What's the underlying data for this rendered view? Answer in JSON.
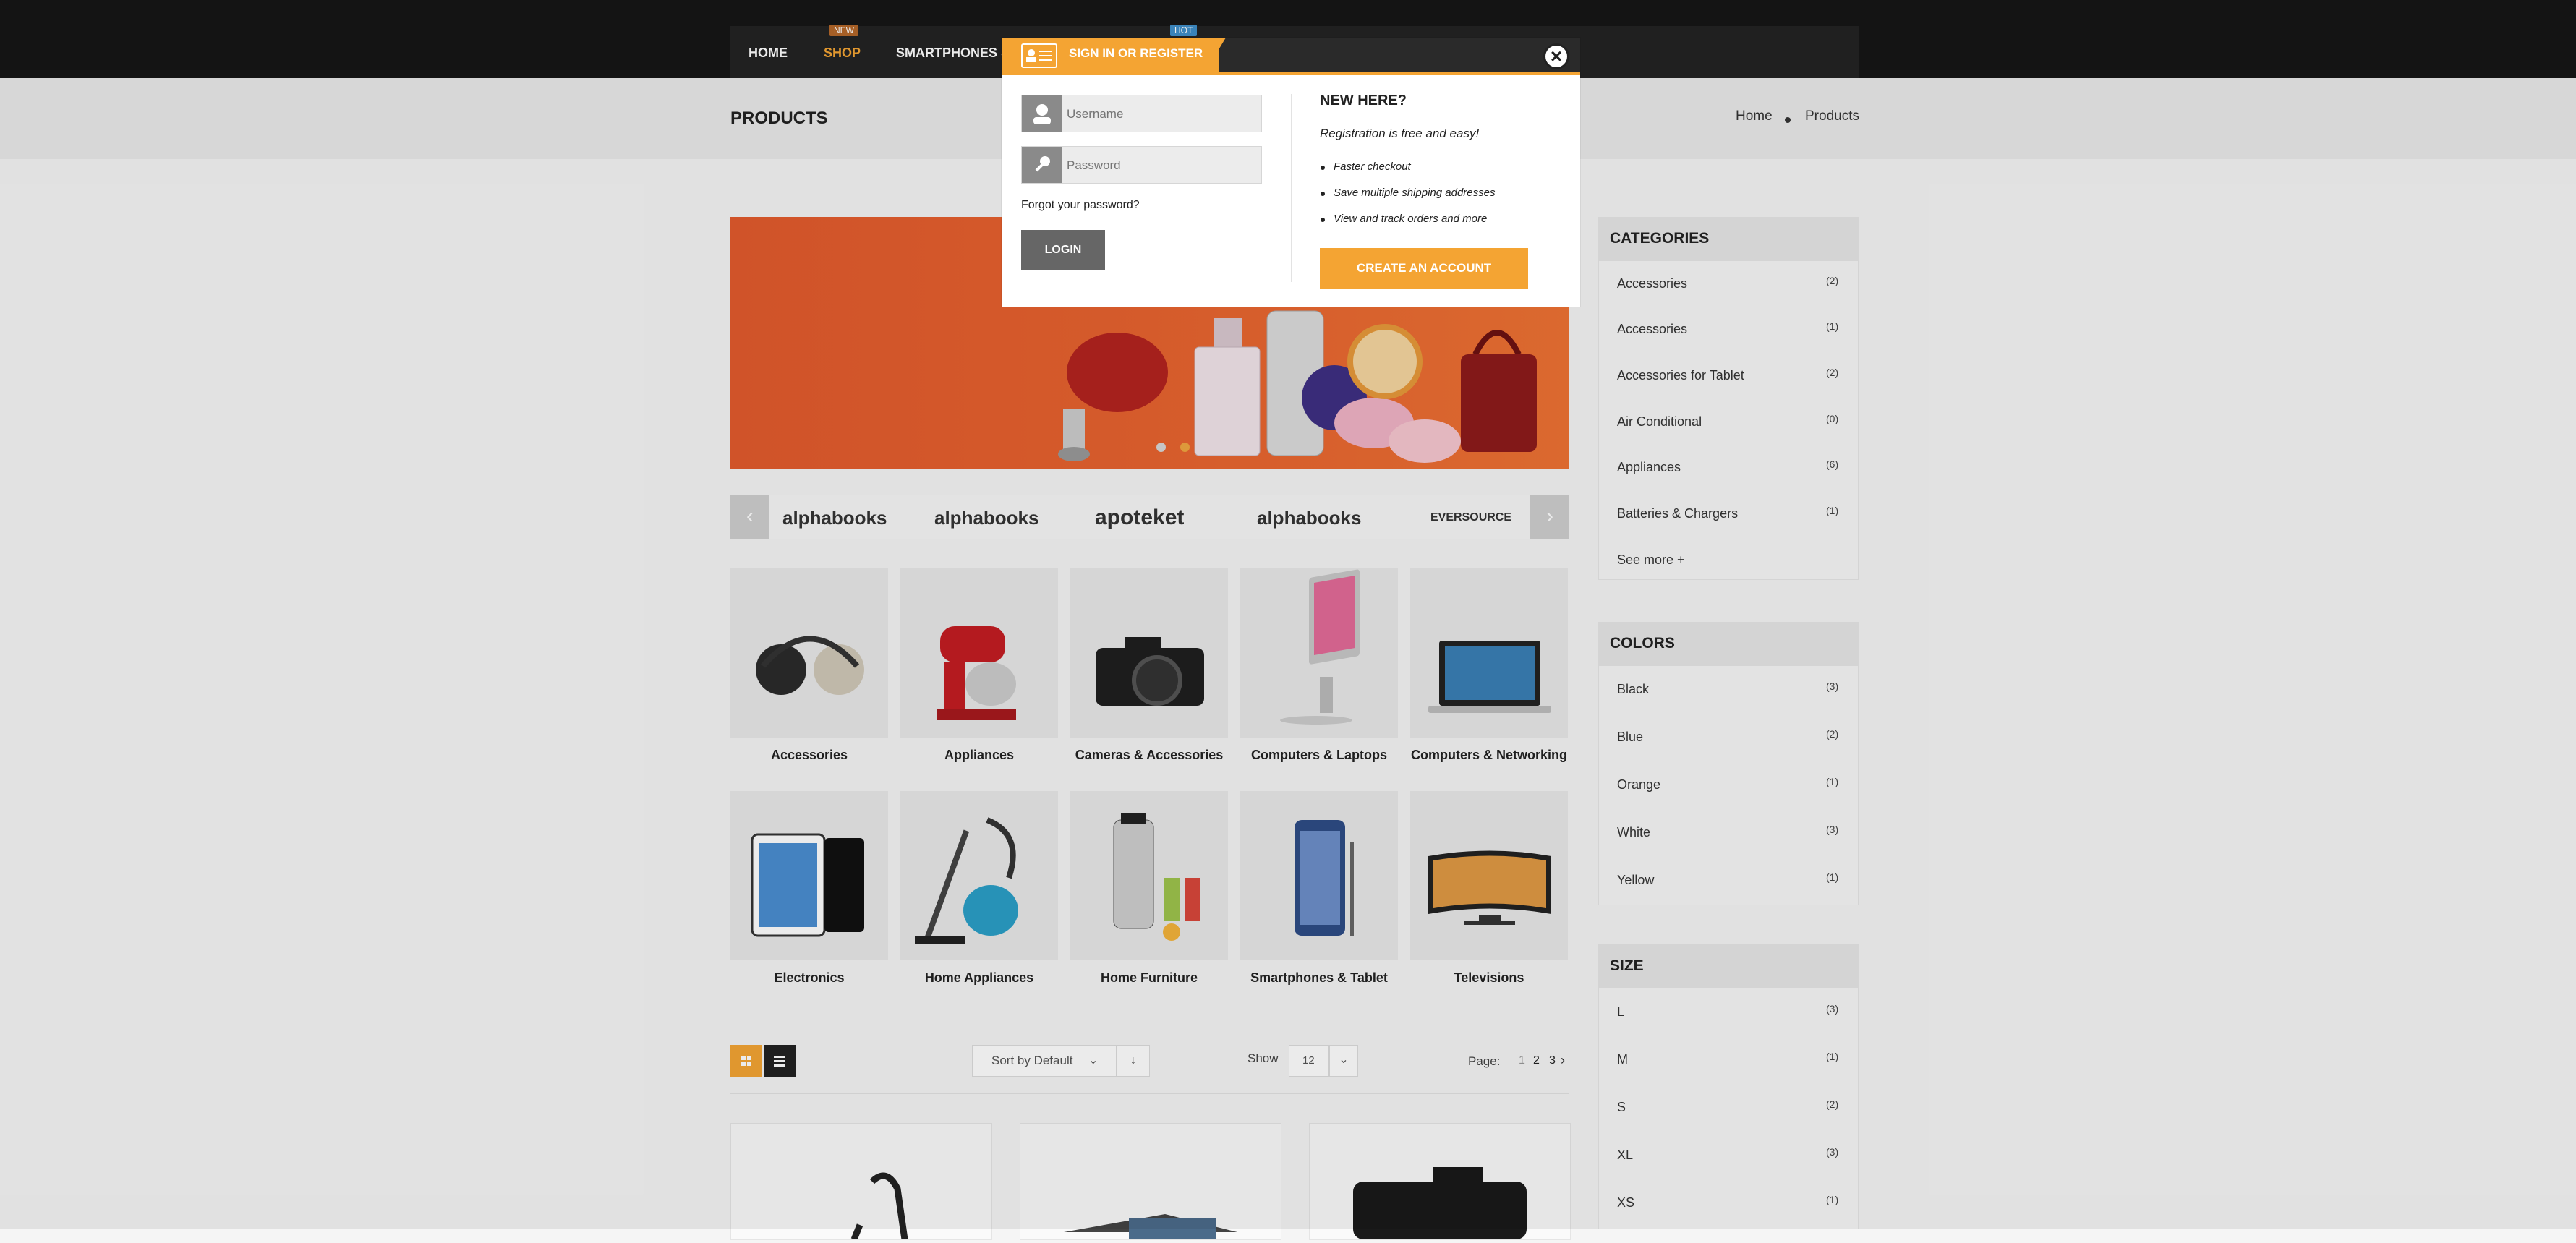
{
  "nav": {
    "items": [
      {
        "label": "HOME"
      },
      {
        "label": "SHOP",
        "badge": "NEW"
      },
      {
        "label": "SMARTPHONES &",
        "badge": "HOT"
      }
    ]
  },
  "header": {
    "page_title": "PRODUCTS",
    "breadcrumb": [
      "Home",
      "Products"
    ]
  },
  "slider": {
    "dots": 2
  },
  "brands": {
    "logos": [
      "alphabooks",
      "alphabooks",
      "apoteket",
      "alphabooks",
      "EVERSOURCE"
    ],
    "prev_icon": "chevron-left-icon",
    "next_icon": "chevron-right-icon"
  },
  "categories": [
    {
      "label": "Accessories",
      "icon": "headphones"
    },
    {
      "label": "Appliances",
      "icon": "stand-mixer"
    },
    {
      "label": "Cameras & Accessories",
      "icon": "camera"
    },
    {
      "label": "Computers & Laptops",
      "icon": "imac"
    },
    {
      "label": "Computers & Networking",
      "icon": "laptop"
    },
    {
      "label": "Electronics",
      "icon": "tablets"
    },
    {
      "label": "Home Appliances",
      "icon": "vacuum"
    },
    {
      "label": "Home Furniture",
      "icon": "juicer"
    },
    {
      "label": "Smartphones & Tablet",
      "icon": "smartphone"
    },
    {
      "label": "Televisions",
      "icon": "tv"
    }
  ],
  "toolbar": {
    "sort_label": "Sort by Default",
    "show_label": "Show",
    "show_value": "12",
    "page_label": "Page:",
    "pages": [
      "1",
      "2",
      "3"
    ],
    "next_label": "›"
  },
  "sidebar": {
    "categories_title": "CATEGORIES",
    "categories": [
      {
        "label": "Accessories",
        "count": "(2)"
      },
      {
        "label": "Accessories",
        "count": "(1)"
      },
      {
        "label": "Accessories for Tablet",
        "count": "(2)"
      },
      {
        "label": "Air Conditional",
        "count": "(0)"
      },
      {
        "label": "Appliances",
        "count": "(6)"
      },
      {
        "label": "Batteries & Chargers",
        "count": "(1)"
      }
    ],
    "see_more": "See more +",
    "colors_title": "COLORS",
    "colors": [
      {
        "label": "Black",
        "count": "(3)"
      },
      {
        "label": "Blue",
        "count": "(2)"
      },
      {
        "label": "Orange",
        "count": "(1)"
      },
      {
        "label": "White",
        "count": "(3)"
      },
      {
        "label": "Yellow",
        "count": "(1)"
      }
    ],
    "size_title": "SIZE",
    "sizes": [
      {
        "label": "L",
        "count": "(3)"
      },
      {
        "label": "M",
        "count": "(1)"
      },
      {
        "label": "S",
        "count": "(2)"
      },
      {
        "label": "XL",
        "count": "(3)"
      },
      {
        "label": "XS",
        "count": "(1)"
      }
    ]
  },
  "modal": {
    "title": "SIGN IN OR REGISTER",
    "username_placeholder": "Username",
    "password_placeholder": "Password",
    "forgot": "Forgot your password?",
    "login": "LOGIN",
    "new_here": "NEW HERE?",
    "reg_text": "Registration is free and easy!",
    "benefits": [
      "Faster checkout",
      "Save multiple shipping addresses",
      "View and track orders and more"
    ],
    "create": "CREATE AN ACCOUNT"
  },
  "colors": {
    "accent": "#f4a433",
    "dark": "#161616",
    "slider_bg": "#e8632f"
  }
}
